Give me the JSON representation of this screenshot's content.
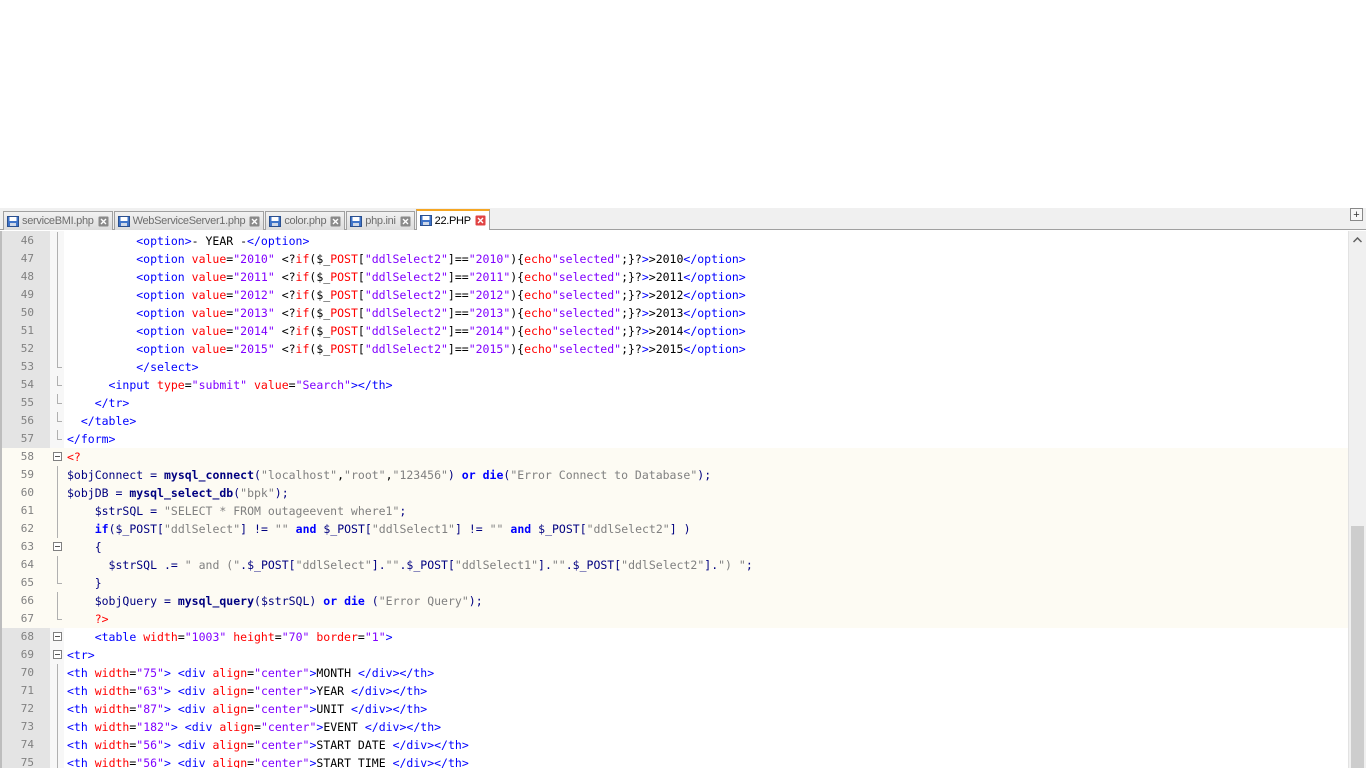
{
  "tabs": [
    {
      "label": "serviceBMI.php",
      "active": false
    },
    {
      "label": "WebServiceServer1.php",
      "active": false
    },
    {
      "label": "color.php",
      "active": false
    },
    {
      "label": "php.ini",
      "active": false
    },
    {
      "label": "22.PHP",
      "active": true
    }
  ],
  "add_tab_label": "+",
  "colors": {
    "tag": "#0000ff",
    "attribute": "#ff0000",
    "string": "#8000ff",
    "php_delimiter": "#ff0000",
    "php_keyword": "#0000ff",
    "php_string": "#808080",
    "php_variable": "#000080",
    "php_function": "#000080",
    "php_bg": "#fdfbf3",
    "active_tab_accent": "#f5a623"
  },
  "editor": {
    "lines": [
      {
        "n": "46",
        "fold": "bar",
        "php": false,
        "text": "          <option>- YEAR -</option>"
      },
      {
        "n": "47",
        "fold": "bar",
        "php": false,
        "text": "          <option value=\"2010\" <?if($_POST[\"ddlSelect2\"]==\"2010\"){echo\"selected\";}?>>2010</option>"
      },
      {
        "n": "48",
        "fold": "bar",
        "php": false,
        "text": "          <option value=\"2011\" <?if($_POST[\"ddlSelect2\"]==\"2011\"){echo\"selected\";}?>>2011</option>"
      },
      {
        "n": "49",
        "fold": "bar",
        "php": false,
        "text": "          <option value=\"2012\" <?if($_POST[\"ddlSelect2\"]==\"2012\"){echo\"selected\";}?>>2012</option>"
      },
      {
        "n": "50",
        "fold": "bar",
        "php": false,
        "text": "          <option value=\"2013\" <?if($_POST[\"ddlSelect2\"]==\"2013\"){echo\"selected\";}?>>2013</option>"
      },
      {
        "n": "51",
        "fold": "bar",
        "php": false,
        "text": "          <option value=\"2014\" <?if($_POST[\"ddlSelect2\"]==\"2014\"){echo\"selected\";}?>>2014</option>"
      },
      {
        "n": "52",
        "fold": "bar",
        "php": false,
        "text": "          <option value=\"2015\" <?if($_POST[\"ddlSelect2\"]==\"2015\"){echo\"selected\";}?>>2015</option>"
      },
      {
        "n": "53",
        "fold": "end",
        "php": false,
        "text": "          </select>"
      },
      {
        "n": "54",
        "fold": "end",
        "php": false,
        "text": "      <input type=\"submit\" value=\"Search\"></th>"
      },
      {
        "n": "55",
        "fold": "end",
        "php": false,
        "text": "    </tr>"
      },
      {
        "n": "56",
        "fold": "end",
        "php": false,
        "text": "  </table>"
      },
      {
        "n": "57",
        "fold": "end",
        "php": false,
        "text": "</form>"
      },
      {
        "n": "58",
        "fold": "box",
        "php": true,
        "text": "<?"
      },
      {
        "n": "59",
        "fold": "bar",
        "php": true,
        "text": "$objConnect = mysql_connect(\"localhost\",\"root\",\"123456\") or die(\"Error Connect to Database\");"
      },
      {
        "n": "60",
        "fold": "bar",
        "php": true,
        "text": "$objDB = mysql_select_db(\"bpk\");"
      },
      {
        "n": "61",
        "fold": "bar",
        "php": true,
        "text": "    $strSQL = \"SELECT * FROM outageevent where1\";"
      },
      {
        "n": "62",
        "fold": "bar",
        "php": true,
        "text": "    if($_POST[\"ddlSelect\"] != \"\" and $_POST[\"ddlSelect1\"] != \"\" and $_POST[\"ddlSelect2\"] )"
      },
      {
        "n": "63",
        "fold": "box",
        "php": true,
        "text": "    {"
      },
      {
        "n": "64",
        "fold": "bar",
        "php": true,
        "text": "      $strSQL .= \" and (\".$_POST[\"ddlSelect\"].\"\".$_POST[\"ddlSelect1\"].\"\".$_POST[\"ddlSelect2\"].\") \";"
      },
      {
        "n": "65",
        "fold": "end",
        "php": true,
        "text": "    }"
      },
      {
        "n": "66",
        "fold": "bar",
        "php": true,
        "text": "    $objQuery = mysql_query($strSQL) or die (\"Error Query\");"
      },
      {
        "n": "67",
        "fold": "end",
        "php": true,
        "text": "    ?>"
      },
      {
        "n": "68",
        "fold": "box",
        "php": false,
        "text": "    <table width=\"1003\" height=\"70\" border=\"1\">"
      },
      {
        "n": "69",
        "fold": "box",
        "php": false,
        "text": "<tr>"
      },
      {
        "n": "70",
        "fold": "bar",
        "php": false,
        "text": "<th width=\"75\"> <div align=\"center\">MONTH </div></th>"
      },
      {
        "n": "71",
        "fold": "bar",
        "php": false,
        "text": "<th width=\"63\"> <div align=\"center\">YEAR </div></th>"
      },
      {
        "n": "72",
        "fold": "bar",
        "php": false,
        "text": "<th width=\"87\"> <div align=\"center\">UNIT </div></th>"
      },
      {
        "n": "73",
        "fold": "bar",
        "php": false,
        "text": "<th width=\"182\"> <div align=\"center\">EVENT </div></th>"
      },
      {
        "n": "74",
        "fold": "bar",
        "php": false,
        "text": "<th width=\"56\"> <div align=\"center\">START DATE </div></th>"
      },
      {
        "n": "75",
        "fold": "bar",
        "php": false,
        "text": "<th width=\"56\"> <div align=\"center\">START TIME </div></th>"
      }
    ]
  }
}
